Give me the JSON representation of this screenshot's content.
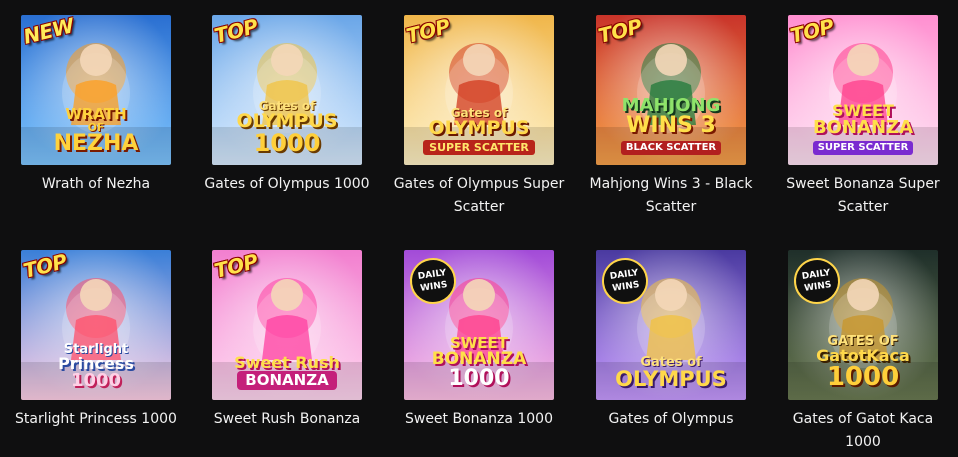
{
  "games": [
    {
      "title": "Wrath of Nezha",
      "badge": "NEW",
      "logo": [
        "WRATH",
        "OF",
        "NEZHA"
      ],
      "colors": {
        "bg1": "#2a6fd1",
        "bg2": "#7fc6ff",
        "accent": "#ff9d1c",
        "logo": "#ffd23c"
      }
    },
    {
      "title": "Gates of Olympus 1000",
      "badge": "TOP",
      "logo": [
        "Gates of",
        "OLYMPUS",
        "1000"
      ],
      "colors": {
        "bg1": "#6aa6e8",
        "bg2": "#d9ecff",
        "accent": "#f1c341",
        "logo": "#ffd84a"
      }
    },
    {
      "title": "Gates of Olympus Super Scatter",
      "badge": "TOP",
      "logo": [
        "Gates of",
        "OLYMPUS",
        "SUPER SCATTER"
      ],
      "colors": {
        "bg1": "#f0b64a",
        "bg2": "#fff2c6",
        "accent": "#d23a1e",
        "logo": "#ffd84a"
      }
    },
    {
      "title": "Mahjong Wins 3 - Black Scatter",
      "badge": "TOP",
      "logo": [
        "MAHJONG",
        "WINS 3",
        "BLACK SCATTER"
      ],
      "colors": {
        "bg1": "#c9342a",
        "bg2": "#f7a24b",
        "accent": "#1f7a3a",
        "logo": "#8ee36a"
      }
    },
    {
      "title": "Sweet Bonanza Super Scatter",
      "badge": "TOP",
      "logo": [
        "SWEET",
        "BONANZA",
        "SUPER SCATTER"
      ],
      "colors": {
        "bg1": "#ff8fd0",
        "bg2": "#ffe3f4",
        "accent": "#ff3d8b",
        "logo": "#ffe04a"
      }
    },
    {
      "title": "Starlight Princess 1000",
      "badge": "TOP",
      "logo": [
        "Starlight",
        "Princess",
        "1000"
      ],
      "colors": {
        "bg1": "#3a7fd8",
        "bg2": "#ffd0e6",
        "accent": "#ff4f6a",
        "logo": "#ffffff"
      }
    },
    {
      "title": "Sweet Rush Bonanza",
      "badge": "TOP",
      "logo": [
        "Sweet Rush",
        "BONANZA"
      ],
      "colors": {
        "bg1": "#f27fcf",
        "bg2": "#ffd7f0",
        "accent": "#ff3fa0",
        "logo": "#ffe04a"
      }
    },
    {
      "title": "Sweet Bonanza 1000",
      "badge": "DAILY WINS",
      "logo": [
        "SWEET",
        "BONANZA",
        "1000"
      ],
      "colors": {
        "bg1": "#a24bd8",
        "bg2": "#ffc2e6",
        "accent": "#ff3d8b",
        "logo": "#ffe04a"
      }
    },
    {
      "title": "Gates of Olympus",
      "badge": "DAILY WINS",
      "logo": [
        "Gates of",
        "OLYMPUS"
      ],
      "colors": {
        "bg1": "#4a3aa0",
        "bg2": "#c79bff",
        "accent": "#f2c23e",
        "logo": "#ffd84a"
      }
    },
    {
      "title": "Gates of Gatot Kaca 1000",
      "badge": "DAILY WINS",
      "logo": [
        "GATES OF",
        "GatotKaca",
        "1000"
      ],
      "colors": {
        "bg1": "#1f2f2a",
        "bg2": "#6a7a52",
        "accent": "#c8962a",
        "logo": "#ffd84a"
      }
    }
  ]
}
